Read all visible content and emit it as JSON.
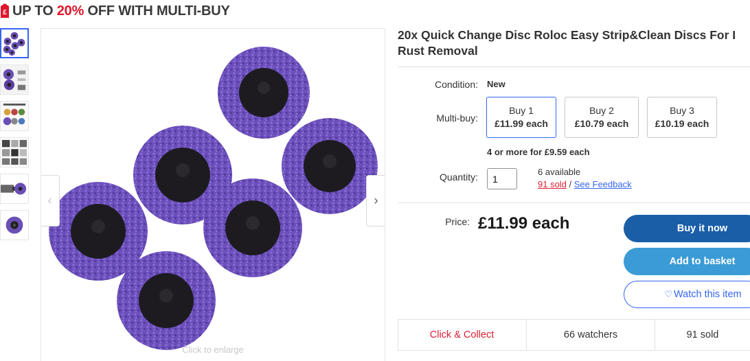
{
  "promo": {
    "prefix": "UP TO ",
    "percent": "20%",
    "suffix": " OFF WITH MULTI-BUY",
    "tag_glyph": "£",
    "accent_color": "#e0162b"
  },
  "gallery": {
    "thumbnails": [
      "thumb-1",
      "thumb-2",
      "thumb-3",
      "thumb-4",
      "thumb-5",
      "thumb-6"
    ],
    "selected_index": 0,
    "enlarge_text": "Click to enlarge",
    "prev_icon": "chevron-left-icon",
    "next_icon": "chevron-right-icon"
  },
  "listing": {
    "title_line1": "20x Quick Change Disc Roloc Easy Strip&Clean Discs For I",
    "title_line2": "Rust Removal",
    "condition_label": "Condition:",
    "condition_value": "New",
    "multibuy_label": "Multi-buy:",
    "multibuy_options": [
      {
        "qty": "Buy 1",
        "price": "£11.99 each"
      },
      {
        "qty": "Buy 2",
        "price": "£10.79 each"
      },
      {
        "qty": "Buy 3",
        "price": "£10.19 each"
      }
    ],
    "multibuy_more": "4 or more for £9.59 each",
    "quantity_label": "Quantity:",
    "quantity_value": "1",
    "available": "6 available",
    "sold_link": "91 sold",
    "sold_sep": " / ",
    "feedback_link": "See Feedback",
    "price_label": "Price:",
    "price_value": "£11.99 each",
    "buttons": {
      "buy_now": "Buy it now",
      "add_basket": "Add to basket",
      "watch": "Watch this item"
    },
    "stats": {
      "collect": "Click & Collect",
      "watchers": "66 watchers",
      "sold": "91 sold"
    }
  },
  "colors": {
    "link_blue": "#3665f3",
    "buy_blue": "#1a5ea8",
    "basket_blue": "#3b9bd6",
    "sold_red": "#dd1e31",
    "disc_purple": "#6a4fb6"
  }
}
